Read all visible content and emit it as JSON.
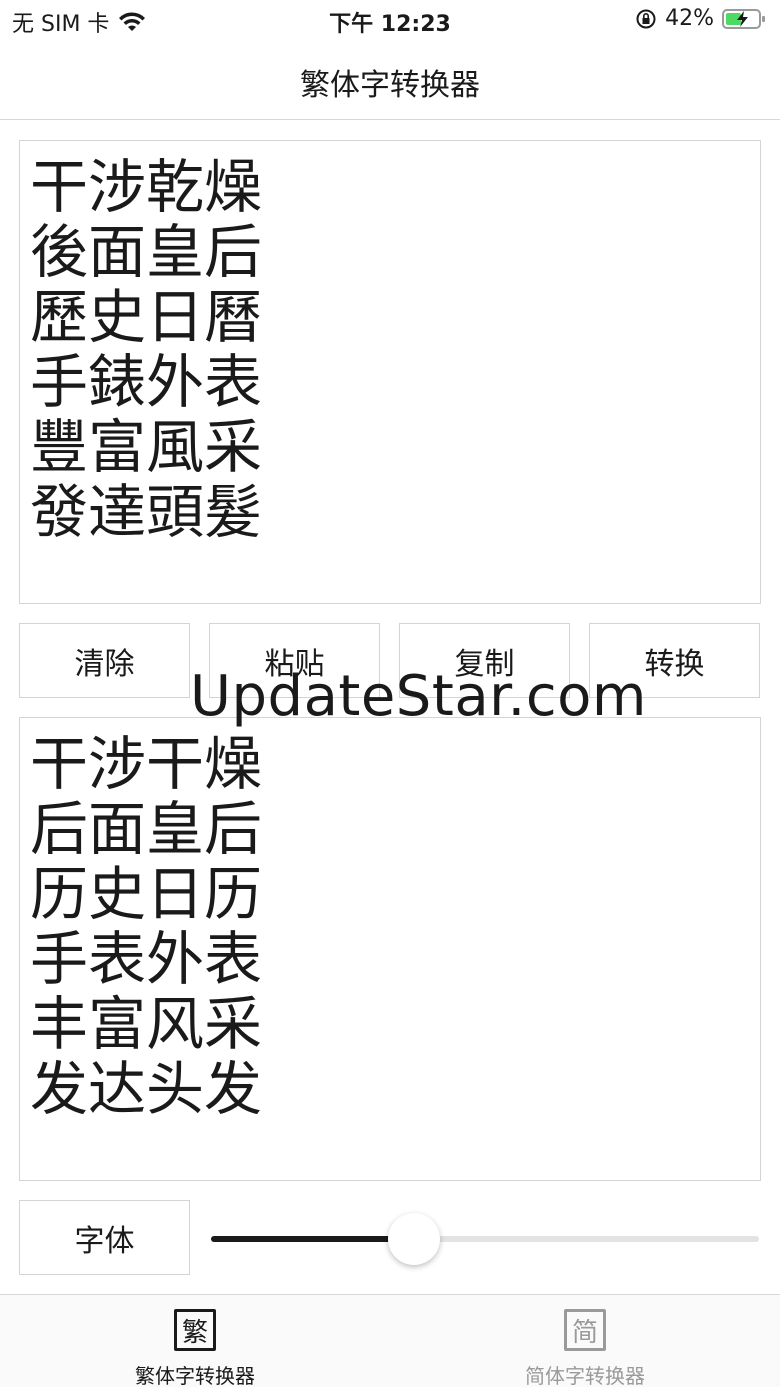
{
  "status_bar": {
    "carrier": "无 SIM 卡",
    "time": "下午 12:23",
    "battery": "42%",
    "icons": [
      "wifi-icon",
      "rotation-lock-icon",
      "battery-charging-icon"
    ]
  },
  "nav": {
    "title": "繁体字转换器"
  },
  "input_text": {
    "lines": [
      "干涉乾燥",
      "後面皇后",
      "歷史日曆",
      "手錶外表",
      "豐富風采",
      "發達頭髮"
    ]
  },
  "buttons": {
    "clear": "清除",
    "paste": "粘贴",
    "copy": "复制",
    "convert": "转换",
    "font": "字体"
  },
  "watermark": "UpdateStar.com",
  "output_text": {
    "lines": [
      "干涉干燥",
      "后面皇后",
      "历史日历",
      "手表外表",
      "丰富风采",
      "发达头发"
    ]
  },
  "font_slider": {
    "value_fraction": 0.37
  },
  "tabs": [
    {
      "icon_char": "繁",
      "label": "繁体字转换器",
      "active": true
    },
    {
      "icon_char": "简",
      "label": "简体字转换器",
      "active": false
    }
  ],
  "colors": {
    "active": "#1a1a1a",
    "inactive": "#9a9a9a",
    "battery": "#4cd964"
  }
}
